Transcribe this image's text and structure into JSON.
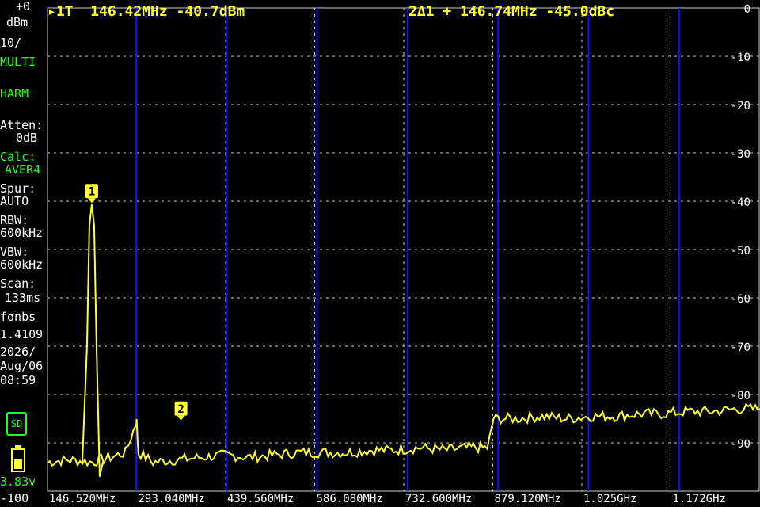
{
  "header": {
    "marker1": "▸1T  146.42MHz -40.7dBm",
    "marker2": "2Δ1 + 146.74MHz -45.0dBc"
  },
  "sidebar": {
    "ref_level": "+0",
    "ref_unit": "dBm",
    "scale": "10/",
    "mode1": "MULTI",
    "mode2": "HARM",
    "atten_label": "Atten:",
    "atten_value": "0dB",
    "calc_label": "Calc:",
    "calc_value": "AVER4",
    "spur_label": "Spur:",
    "spur_value": "AUTO",
    "rbw_label": "RBW:",
    "rbw_value": "600kHz",
    "vbw_label": "VBW:",
    "vbw_value": "600kHz",
    "scan_label": "Scan:",
    "scan_value": "133ms",
    "fw_label": "fσnbs",
    "fw_value": "1.4109",
    "date": "2026/",
    "date2": "Aug/06",
    "time": "08:59",
    "sd_label": "SD",
    "battery": "3.83v",
    "bottom_level": "-100"
  },
  "colors": {
    "trace": "#ffff33",
    "grid": "#cfcfcf",
    "harmonic_lines": "#1010ff",
    "accent_green": "#22ff22"
  },
  "icons": [
    "sd-card-icon",
    "battery-icon"
  ],
  "chart_data": {
    "type": "line",
    "title": "",
    "xlabel": "",
    "ylabel": "",
    "x_ticks": [
      "146.520MHz",
      "293.040MHz",
      "439.560MHz",
      "586.080MHz",
      "732.600MHz",
      "879.120MHz",
      "1.025GHz",
      "1.172GHz"
    ],
    "y_ticks": [
      "0",
      "-10",
      "-20",
      "-30",
      "-40",
      "-50",
      "-60",
      "-70",
      "-80",
      "-90"
    ],
    "ylim": [
      -100,
      0
    ],
    "xlim_MHz": [
      146.52,
      1318.68
    ],
    "markers": [
      {
        "label": "1",
        "freq_MHz": 146.42,
        "level_dBm": -40.7
      },
      {
        "label": "2",
        "freq_MHz": 293.16,
        "level_dBm": -85.7
      }
    ],
    "series": [
      {
        "values_MHz_dBm": [
          [
            146.52,
            -94
          ],
          [
            180,
            -93.5
          ],
          [
            220,
            -94
          ],
          [
            250,
            -93
          ],
          [
            275,
            -92
          ],
          [
            292,
            -86
          ],
          [
            293.16,
            -85.7
          ],
          [
            296,
            -92
          ],
          [
            320,
            -94
          ],
          [
            360,
            -93.5
          ],
          [
            400,
            -93
          ],
          [
            440,
            -92.5
          ],
          [
            480,
            -93
          ],
          [
            520,
            -92.5
          ],
          [
            560,
            -92
          ],
          [
            600,
            -92
          ],
          [
            640,
            -92
          ],
          [
            680,
            -91.5
          ],
          [
            720,
            -91.5
          ],
          [
            760,
            -91
          ],
          [
            800,
            -91.5
          ],
          [
            840,
            -91
          ],
          [
            870,
            -91
          ],
          [
            878,
            -87
          ],
          [
            880,
            -85
          ],
          [
            920,
            -85
          ],
          [
            960,
            -84.5
          ],
          [
            1000,
            -85
          ],
          [
            1040,
            -84.5
          ],
          [
            1080,
            -84.5
          ],
          [
            1120,
            -84
          ],
          [
            1160,
            -84
          ],
          [
            1200,
            -83.5
          ],
          [
            1240,
            -83.5
          ],
          [
            1280,
            -83
          ],
          [
            1318.68,
            -83
          ]
        ],
        "peak": {
          "freq_MHz": 146.42,
          "level_dBm": -40.7
        }
      }
    ]
  }
}
